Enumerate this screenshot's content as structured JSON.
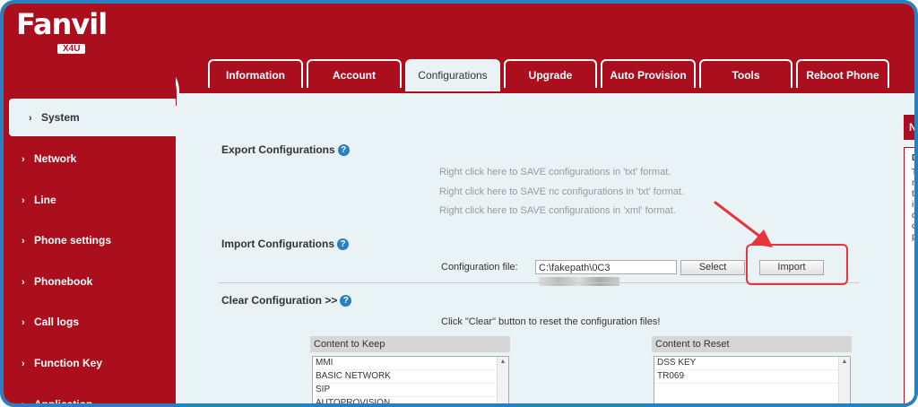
{
  "header": {
    "brand": "Fanvil",
    "model": "X4U"
  },
  "tabs": [
    {
      "label": "Information",
      "active": false
    },
    {
      "label": "Account",
      "active": false
    },
    {
      "label": "Configurations",
      "active": true
    },
    {
      "label": "Upgrade",
      "active": false
    },
    {
      "label": "Auto Provision",
      "active": false
    },
    {
      "label": "Tools",
      "active": false
    },
    {
      "label": "Reboot Phone",
      "active": false
    }
  ],
  "sidebar": {
    "items": [
      {
        "label": "System",
        "active": true
      },
      {
        "label": "Network",
        "active": false
      },
      {
        "label": "Line",
        "active": false
      },
      {
        "label": "Phone settings",
        "active": false
      },
      {
        "label": "Phonebook",
        "active": false
      },
      {
        "label": "Call logs",
        "active": false
      },
      {
        "label": "Function Key",
        "active": false
      },
      {
        "label": "Application",
        "active": false
      }
    ]
  },
  "export": {
    "title": "Export Configurations",
    "links": [
      "Right click here to SAVE configurations in 'txt' format.",
      "Right click here to SAVE nc configurations in 'txt' format.",
      "Right click here to SAVE configurations in 'xml' format."
    ]
  },
  "import": {
    "title": "Import Configurations",
    "file_label": "Configuration file:",
    "file_value": "C:\\fakepath\\0C3",
    "select_label": "Select",
    "import_label": "Import"
  },
  "clear": {
    "title": "Clear Configuration >>",
    "instruction": "Click \"Clear\" button to reset the configuration files!",
    "keep_header": "Content to Keep",
    "keep_items": [
      "MMI",
      "BASIC NETWORK",
      "SIP",
      "AUTOPROVISION"
    ],
    "reset_header": "Content to Reset",
    "reset_items": [
      "DSS KEY",
      "TR069"
    ]
  },
  "right_panel": {
    "head": "N",
    "title": "D",
    "lines": [
      "T",
      "m",
      "th",
      "in",
      "cc",
      "cc",
      "pa"
    ]
  },
  "colors": {
    "brand_red": "#ab0f1e",
    "content_bg": "#e9f3f6",
    "highlight": "#e8343a",
    "help_blue": "#2c7ec4"
  }
}
